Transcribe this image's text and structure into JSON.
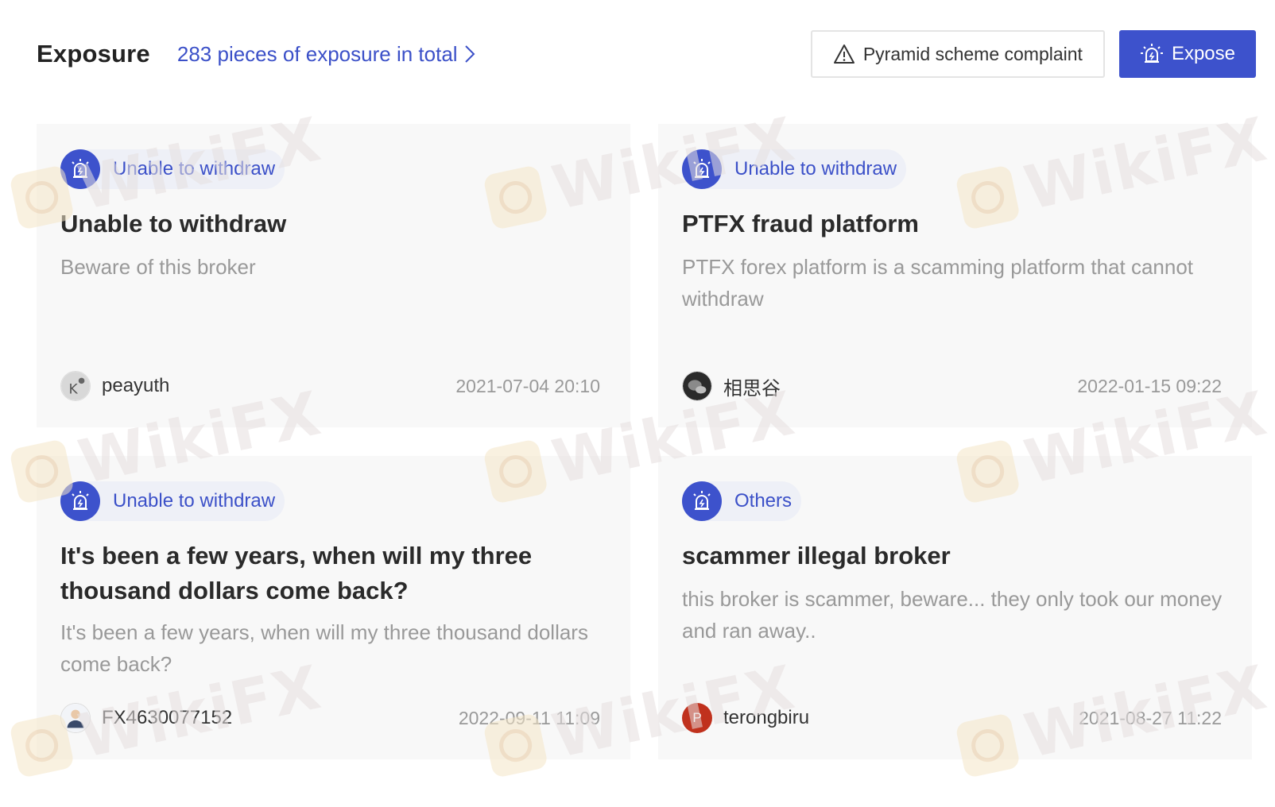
{
  "header": {
    "title": "Exposure",
    "total_link": "283 pieces of exposure in total",
    "complaint_button": "Pyramid scheme complaint",
    "expose_button": "Expose"
  },
  "watermark": {
    "text": "WikiFX"
  },
  "colors": {
    "accent": "#3d52cc",
    "card_bg": "#f8f8f8",
    "tag_bg": "#eef0f7",
    "muted": "#999999"
  },
  "cards": [
    {
      "tag": "Unable to withdraw",
      "title": "Unable to withdraw",
      "description": "Beware of this broker",
      "user": "peayuth",
      "time": "2021-07-04 20:10",
      "avatar_icon": "k-avatar-icon"
    },
    {
      "tag": "Unable to withdraw",
      "title": "PTFX fraud platform",
      "description": "PTFX forex platform is a scamming platform that cannot withdraw",
      "user": "相思谷",
      "time": "2022-01-15 09:22",
      "avatar_icon": "photo-avatar-icon"
    },
    {
      "tag": "Unable to withdraw",
      "title": "It's been a few years, when will my three thousand dollars come back?",
      "description": "It's been a few years, when will my three thousand dollars come back?",
      "user": "FX4630077152",
      "time": "2022-09-11 11:09",
      "avatar_icon": "default-user-avatar-icon"
    },
    {
      "tag": "Others",
      "title": "scammer illegal broker",
      "description": "this broker is scammer, beware... they only took our money and ran away..",
      "user": "terongbiru",
      "time": "2021-08-27 11:22",
      "avatar_letter": "P"
    }
  ]
}
